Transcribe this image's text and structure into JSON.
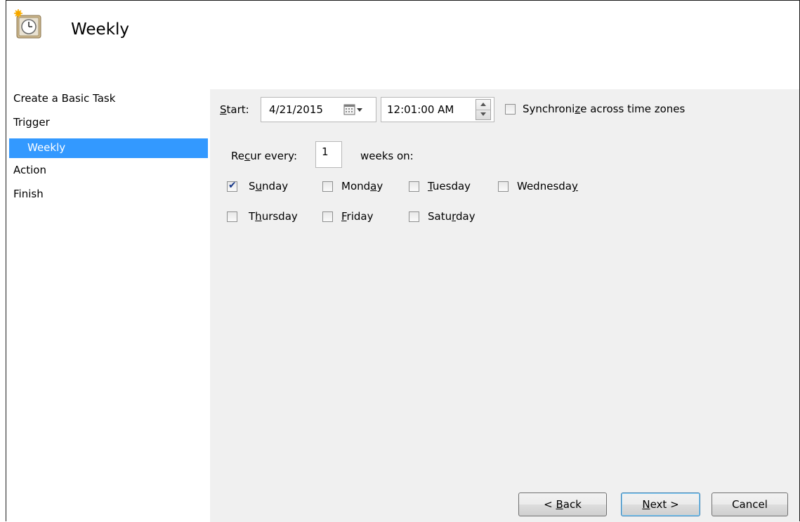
{
  "window": {
    "title": "Weekly"
  },
  "sidebar": {
    "items": [
      {
        "label": "Create a Basic Task"
      },
      {
        "label": "Trigger"
      },
      {
        "label": "Weekly"
      },
      {
        "label": "Action"
      },
      {
        "label": "Finish"
      }
    ]
  },
  "start": {
    "label_pre": "",
    "label_hotkey": "S",
    "label_post": "tart:",
    "date": "4/21/2015",
    "time": "12:01:00 AM",
    "sync_pre": "Synchroni",
    "sync_hotkey": "z",
    "sync_post": "e across time zones",
    "sync_checked": false
  },
  "recur": {
    "label_pre": "Re",
    "label_hotkey": "c",
    "label_post": "ur every:",
    "value": "1",
    "suffix": "weeks on:"
  },
  "days": [
    {
      "pre": "S",
      "hotkey": "u",
      "post": "nday",
      "checked": true
    },
    {
      "pre": "Mond",
      "hotkey": "a",
      "post": "y",
      "checked": false
    },
    {
      "pre": "",
      "hotkey": "T",
      "post": "uesday",
      "checked": false
    },
    {
      "pre": "Wednesda",
      "hotkey": "y",
      "post": "",
      "checked": false
    },
    {
      "pre": "T",
      "hotkey": "h",
      "post": "ursday",
      "checked": false
    },
    {
      "pre": "",
      "hotkey": "F",
      "post": "riday",
      "checked": false
    },
    {
      "pre": "Satu",
      "hotkey": "r",
      "post": "day",
      "checked": false
    }
  ],
  "buttons": {
    "back_pre": "< ",
    "back_hotkey": "B",
    "back_post": "ack",
    "next_pre": "",
    "next_hotkey": "N",
    "next_post": "ext >",
    "cancel": "Cancel"
  },
  "colors": {
    "selection": "#3399ff",
    "panel": "#f0f0f0"
  }
}
